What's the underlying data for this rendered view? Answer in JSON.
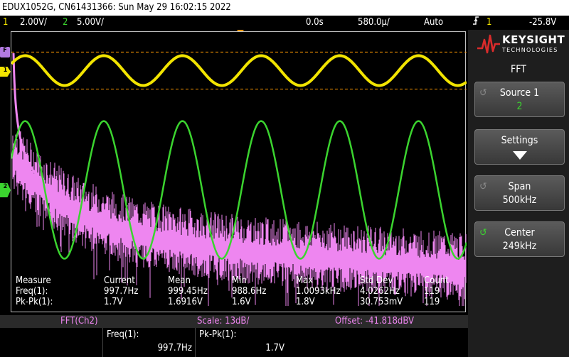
{
  "titlebar": {
    "text": "EDUX1052G, CN61431366: Sun May 29 16:02:15 2022"
  },
  "status": {
    "ch1_num": "1",
    "ch1_scale": "2.00V/",
    "ch2_num": "2",
    "ch2_scale": "5.00V/",
    "time_delay": "0.0s",
    "time_scale": "580.0µ/",
    "trigger_mode": "Auto",
    "trigger_icon": "rising-edge-icon",
    "trigger_ch": "1",
    "trigger_level": "-25.8V"
  },
  "markers": {
    "fft": "F",
    "ch1": "1",
    "ch2": "2"
  },
  "colors": {
    "ch1": "#f2e400",
    "ch2": "#3bd42f",
    "fft": "#ee86f0",
    "trigger": "#ff9900"
  },
  "measurements": {
    "headers": [
      "Measure",
      "Current",
      "Mean",
      "Min",
      "Max",
      "Std Dev",
      "Count"
    ],
    "rows": [
      {
        "name": "Freq(1):",
        "current": "997.7Hz",
        "mean": "999.45Hz",
        "min": "988.6Hz",
        "max": "1.0093kHz",
        "std": "4.0262Hz",
        "count": "119"
      },
      {
        "name": "Pk-Pk(1):",
        "current": "1.7V",
        "mean": "1.6916V",
        "min": "1.6V",
        "max": "1.8V",
        "std": "30.753mV",
        "count": "119"
      }
    ]
  },
  "fft_bar": {
    "source": "FFT(Ch2)",
    "scale": "Scale: 13dB/",
    "offset": "Offset: -41.818dBV"
  },
  "bottom": [
    {
      "label": "Freq(1):",
      "value": "997.7Hz"
    },
    {
      "label": "Pk-Pk(1):",
      "value": "1.7V"
    }
  ],
  "panel": {
    "logo_name": "KEYSIGHT",
    "logo_sub": "TECHNOLOGIES",
    "menu_title": "FFT",
    "softkeys": [
      {
        "label": "Source 1",
        "value": "2",
        "icon": "knob-icon"
      },
      {
        "label": "Settings",
        "value": "",
        "icon": "down-arrow-icon"
      },
      {
        "label": "Span",
        "value": "500kHz",
        "icon": "knob-icon"
      },
      {
        "label": "Center",
        "value": "249kHz",
        "icon": "knob-icon"
      }
    ]
  },
  "chart_data": {
    "type": "line",
    "title": "",
    "series": [
      {
        "name": "1",
        "kind": "sine",
        "color": "#f2e400",
        "frequency_hz": 997.7,
        "pk_pk_v": 1.7,
        "volts_per_div": 2.0,
        "offset_div": -2.9
      },
      {
        "name": "2",
        "kind": "sine",
        "color": "#3bd42f",
        "frequency_hz": 997.7,
        "volts_per_div": 5.0,
        "amplitude_div": 2.0,
        "offset_div": 0.9
      },
      {
        "name": "FFT(Ch2)",
        "kind": "spectrum",
        "color": "#ee86f0",
        "scale_db_per_div": 13,
        "offset_dbv": -41.818,
        "span_khz": 500,
        "center_khz": 249
      }
    ],
    "time_per_div_us": 580.0,
    "divisions_x": 10,
    "divisions_y": 8,
    "grid": false
  }
}
